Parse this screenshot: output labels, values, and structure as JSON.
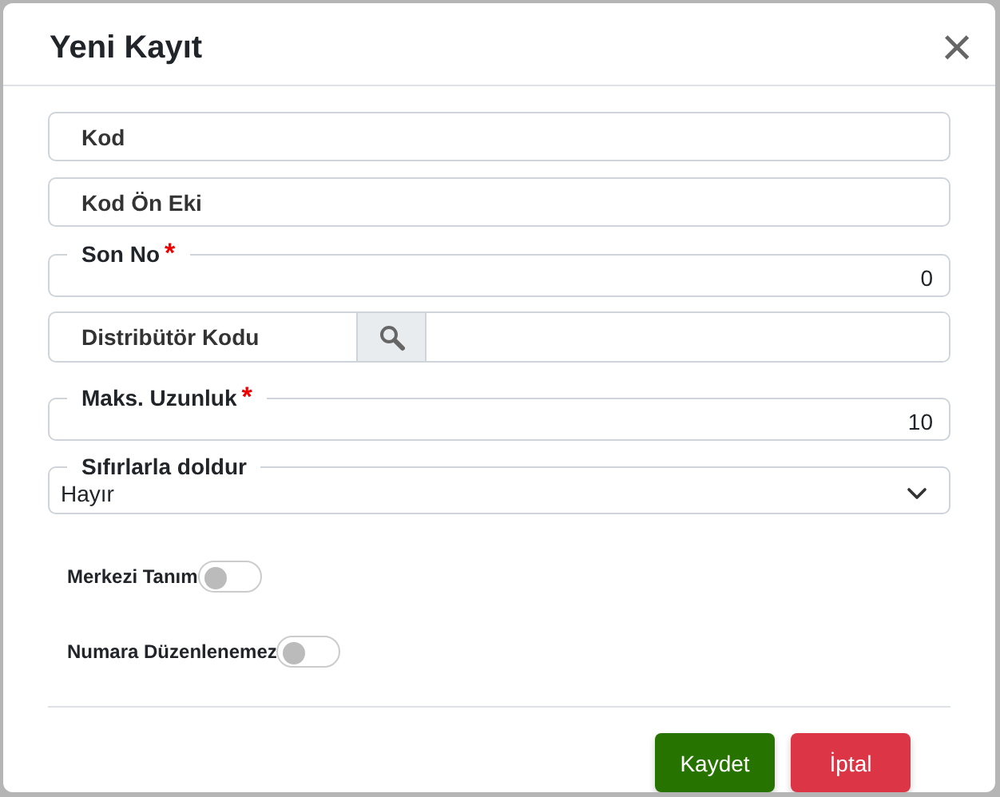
{
  "dialog": {
    "title": "Yeni Kayıt",
    "close": "×"
  },
  "fields": [
    {
      "kind": "plain",
      "placeholder": "Kod"
    },
    {
      "kind": "plain",
      "placeholder": "Kod Ön Eki"
    },
    {
      "kind": "legend",
      "label": "Son No",
      "required_mark": "*",
      "value": "0"
    },
    {
      "kind": "lookup",
      "label": "Distribütör Kodu"
    },
    {
      "kind": "legend",
      "label": "Maks. Uzunluk",
      "required_mark": "*",
      "value": "10"
    },
    {
      "kind": "select",
      "label": "Sıfırlarla doldur",
      "value": "Hayır"
    }
  ],
  "toggles": [
    {
      "label": "Merkezi Tanım",
      "on": false
    },
    {
      "label": "Numara Düzenlenemez",
      "on": false
    }
  ],
  "buttons": [
    {
      "kind": "primary",
      "label": "Kaydet"
    },
    {
      "kind": "danger",
      "label": "İptal"
    }
  ]
}
